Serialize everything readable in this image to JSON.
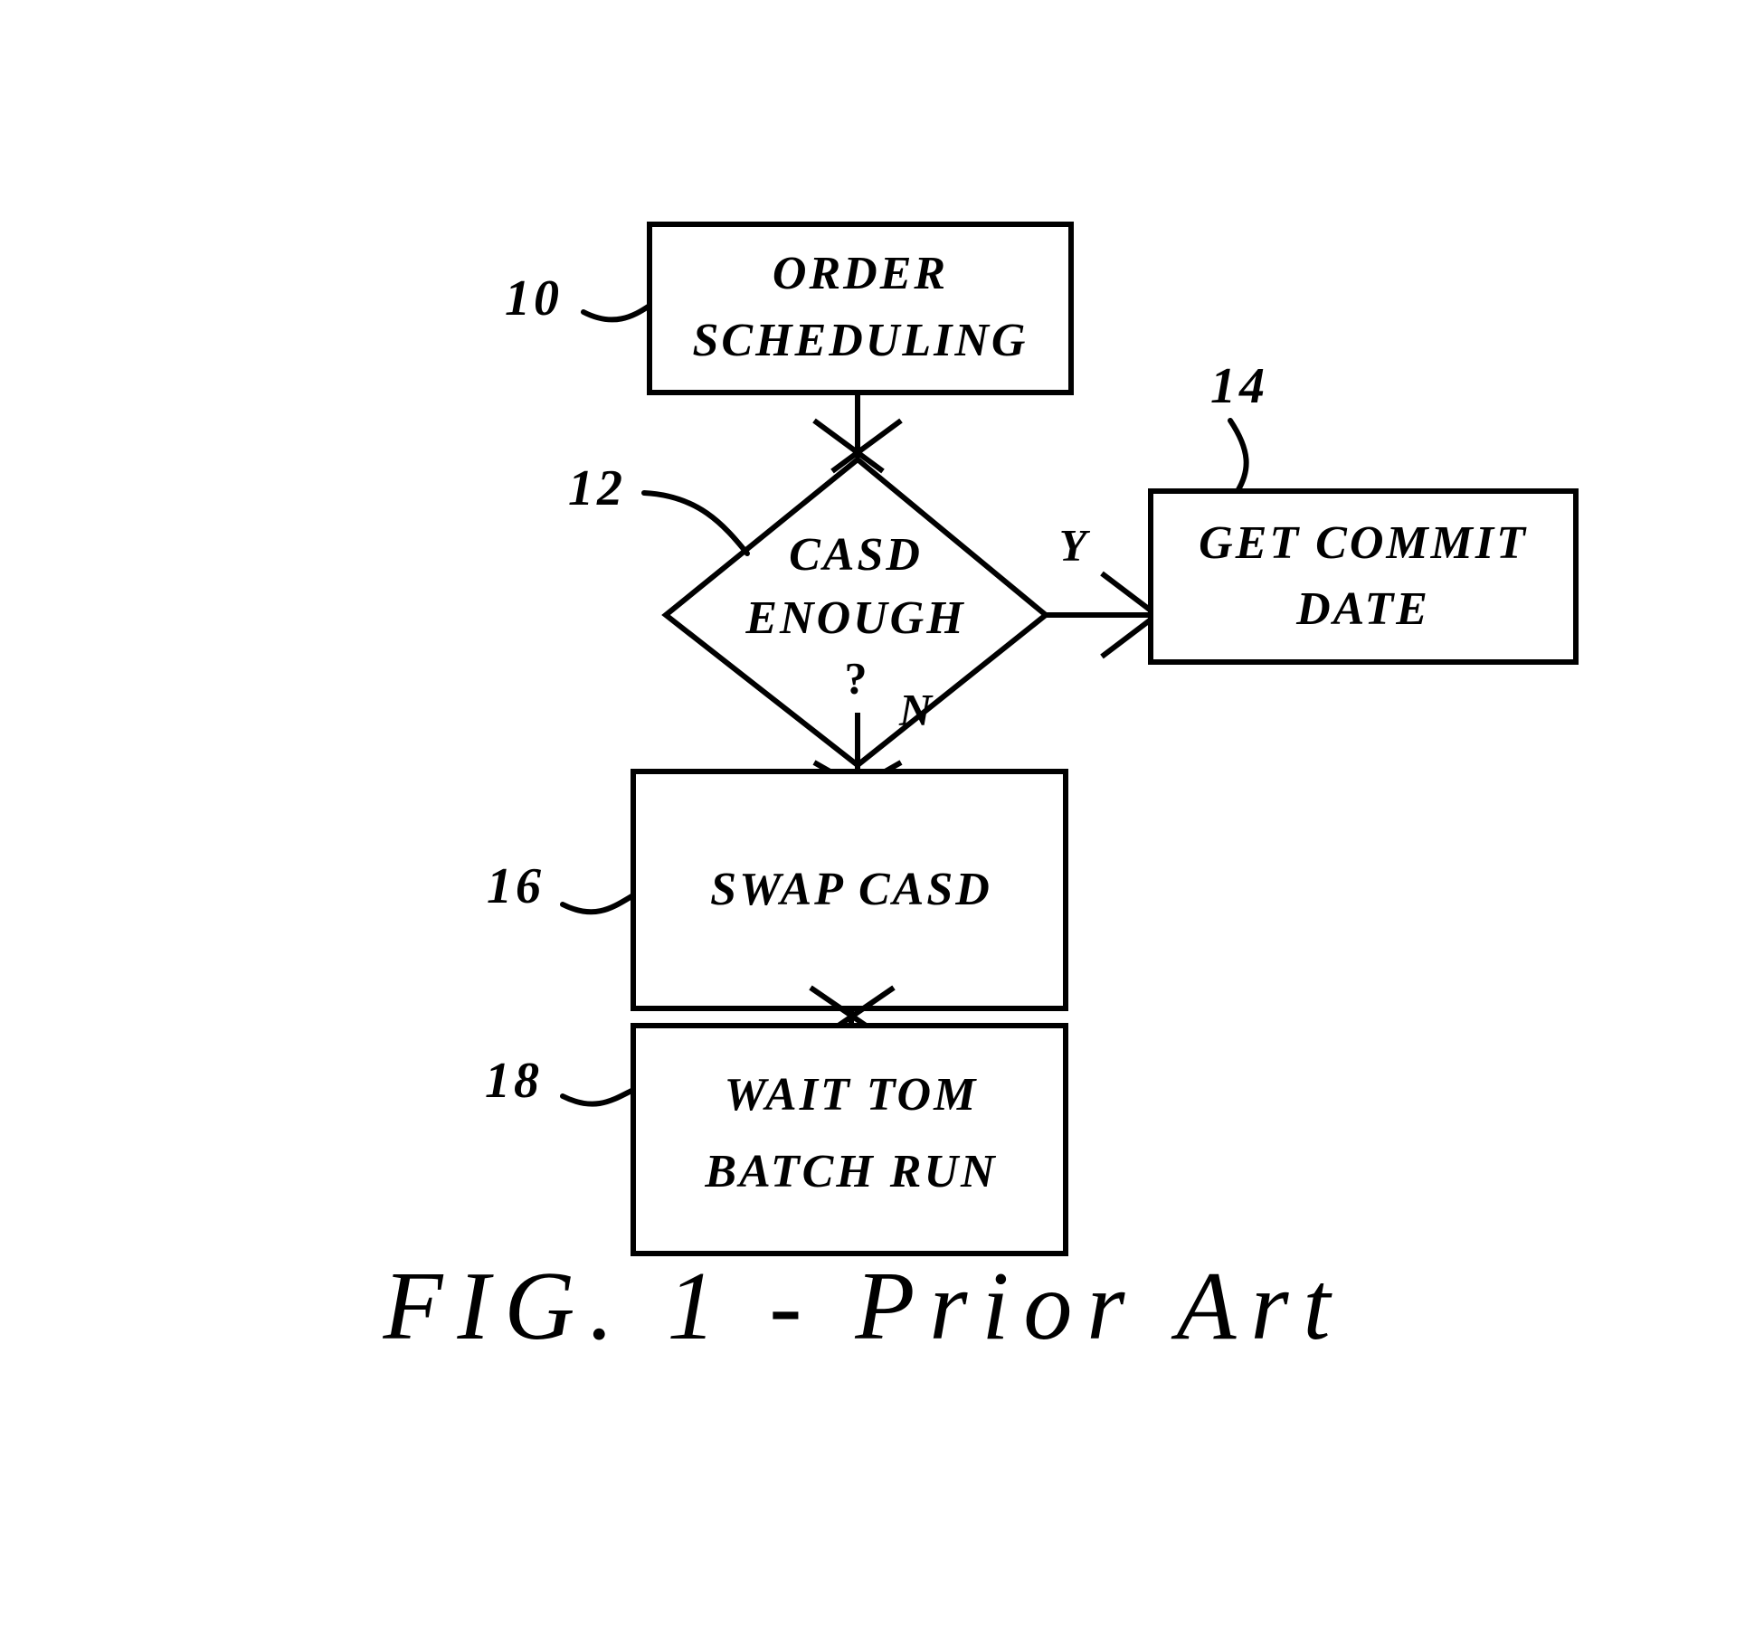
{
  "figure": {
    "caption": "FIG. 1 - Prior Art",
    "caption_parts": {
      "label": "FIG.",
      "number": "1",
      "dash": "-",
      "qualifier": "Prior Art"
    },
    "background_color": "#ffffff",
    "line_color": "#000000"
  },
  "nodes": [
    {
      "id": "order-scheduling",
      "ref": "10",
      "shape": "rectangle",
      "line1": "ORDER",
      "line2": "SCHEDULING"
    },
    {
      "id": "casd-enough",
      "ref": "12",
      "shape": "diamond",
      "line1": "CASD",
      "line2": "ENOUGH",
      "line3": "?"
    },
    {
      "id": "get-commit-date",
      "ref": "14",
      "shape": "rectangle",
      "line1": "GET COMMIT",
      "line2": "DATE"
    },
    {
      "id": "swap-casd",
      "ref": "16",
      "shape": "rectangle",
      "line1": "SWAP CASD",
      "line2": ""
    },
    {
      "id": "wait-tom-batch-run",
      "ref": "18",
      "shape": "rectangle",
      "line1": "WAIT TOM",
      "line2": "BATCH RUN"
    }
  ],
  "edges": [
    {
      "id": "order-to-decision",
      "from": "order-scheduling",
      "to": "casd-enough",
      "label": ""
    },
    {
      "id": "decision-yes",
      "from": "casd-enough",
      "to": "get-commit-date",
      "label": "Y"
    },
    {
      "id": "decision-no",
      "from": "casd-enough",
      "to": "swap-casd",
      "label": "N"
    },
    {
      "id": "swap-to-wait",
      "from": "swap-casd",
      "to": "wait-tom-batch-run",
      "label": ""
    }
  ]
}
